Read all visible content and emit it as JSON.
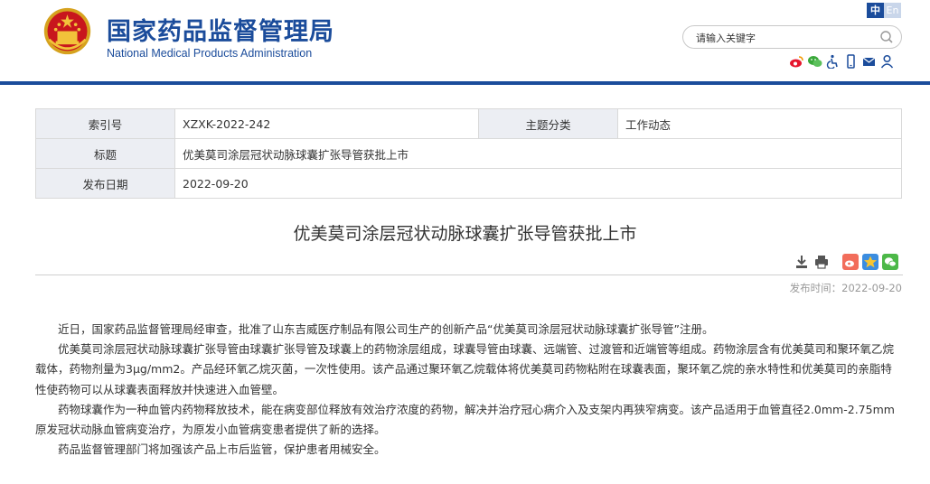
{
  "header": {
    "title_cn": "国家药品监督管理局",
    "title_en": "National Medical Products Administration",
    "lang_cn": "中",
    "lang_en": "En",
    "search_placeholder": "请输入关键字",
    "icons": [
      "weibo-icon",
      "wechat-icon",
      "accessibility-icon",
      "mobile-icon",
      "mail-icon",
      "user-icon"
    ],
    "brand_color": "#1b4c9b"
  },
  "info": {
    "index_label": "索引号",
    "index_value": "XZXK-2022-242",
    "category_label": "主题分类",
    "category_value": "工作动态",
    "title_label": "标题",
    "title_value": "优美莫司涂层冠状动脉球囊扩张导管获批上市",
    "date_label": "发布日期",
    "date_value": "2022-09-20"
  },
  "article": {
    "title": "优美莫司涂层冠状动脉球囊扩张导管获批上市",
    "pub_label": "发布时间：",
    "pub_date": "2022-09-20",
    "paragraphs": [
      "近日，国家药品监督管理局经审查，批准了山东吉威医疗制品有限公司生产的创新产品“优美莫司涂层冠状动脉球囊扩张导管”注册。",
      "优美莫司涂层冠状动脉球囊扩张导管由球囊扩张导管及球囊上的药物涂层组成，球囊导管由球囊、远端管、过渡管和近端管等组成。药物涂层含有优美莫司和聚环氧乙烷载体，药物剂量为3μg/mm2。产品经环氧乙烷灭菌，一次性使用。该产品通过聚环氧乙烷载体将优美莫司药物粘附在球囊表面，聚环氧乙烷的亲水特性和优美莫司的亲脂特性使药物可以从球囊表面释放并快速进入血管壁。",
      "药物球囊作为一种血管内药物释放技术，能在病变部位释放有效治疗浓度的药物，解决并治疗冠心病介入及支架内再狭窄病变。该产品适用于血管直径2.0mm-2.75mm原发冠状动脉血管病变治疗，为原发小血管病变患者提供了新的选择。",
      "药品监督管理部门将加强该产品上市后监管，保护患者用械安全。"
    ],
    "share_icons": [
      "download-icon",
      "print-icon",
      "weibo-share-icon",
      "qzone-share-icon",
      "wechat-share-icon"
    ]
  }
}
